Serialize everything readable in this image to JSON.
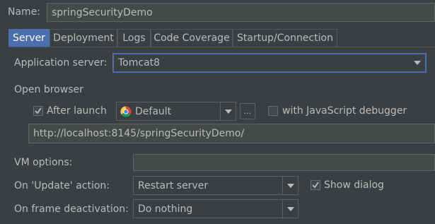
{
  "name": {
    "label": "Name:",
    "value": "springSecurityDemo"
  },
  "tabs": [
    {
      "label": "Server",
      "active": true
    },
    {
      "label": "Deployment"
    },
    {
      "label": "Logs"
    },
    {
      "label": "Code Coverage"
    },
    {
      "label": "Startup/Connection"
    }
  ],
  "app_server": {
    "label": "Application server:",
    "value": "Tomcat8"
  },
  "open_browser": {
    "section_label": "Open browser",
    "after_launch_label": "After launch",
    "after_launch_checked": true,
    "browser_value": "Default",
    "browser_icon": "chrome-icon",
    "more_label": "...",
    "js_debugger_label": "with JavaScript debugger",
    "js_debugger_checked": false,
    "url": "http://localhost:8145/springSecurityDemo/"
  },
  "vm_options": {
    "label": "VM options:",
    "value": ""
  },
  "update_action": {
    "label": "On 'Update' action:",
    "value": "Restart server",
    "show_dialog_label": "Show dialog",
    "show_dialog_checked": true
  },
  "frame_deactivation": {
    "label": "On frame deactivation:",
    "value": "Do nothing"
  },
  "colors": {
    "background": "#3c3f41",
    "accent": "#4b6eaf",
    "text": "#bbbbbb"
  }
}
